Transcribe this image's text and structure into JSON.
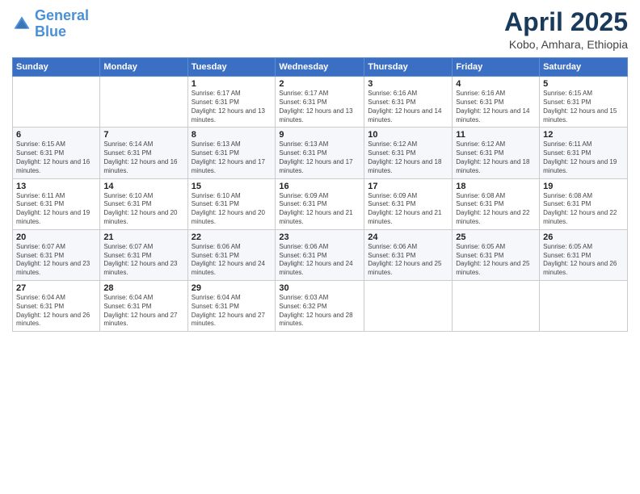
{
  "header": {
    "logo_line1": "General",
    "logo_line2": "Blue",
    "month_title": "April 2025",
    "location": "Kobo, Amhara, Ethiopia"
  },
  "days_of_week": [
    "Sunday",
    "Monday",
    "Tuesday",
    "Wednesday",
    "Thursday",
    "Friday",
    "Saturday"
  ],
  "weeks": [
    [
      {
        "num": "",
        "sunrise": "",
        "sunset": "",
        "daylight": ""
      },
      {
        "num": "",
        "sunrise": "",
        "sunset": "",
        "daylight": ""
      },
      {
        "num": "1",
        "sunrise": "Sunrise: 6:17 AM",
        "sunset": "Sunset: 6:31 PM",
        "daylight": "Daylight: 12 hours and 13 minutes."
      },
      {
        "num": "2",
        "sunrise": "Sunrise: 6:17 AM",
        "sunset": "Sunset: 6:31 PM",
        "daylight": "Daylight: 12 hours and 13 minutes."
      },
      {
        "num": "3",
        "sunrise": "Sunrise: 6:16 AM",
        "sunset": "Sunset: 6:31 PM",
        "daylight": "Daylight: 12 hours and 14 minutes."
      },
      {
        "num": "4",
        "sunrise": "Sunrise: 6:16 AM",
        "sunset": "Sunset: 6:31 PM",
        "daylight": "Daylight: 12 hours and 14 minutes."
      },
      {
        "num": "5",
        "sunrise": "Sunrise: 6:15 AM",
        "sunset": "Sunset: 6:31 PM",
        "daylight": "Daylight: 12 hours and 15 minutes."
      }
    ],
    [
      {
        "num": "6",
        "sunrise": "Sunrise: 6:15 AM",
        "sunset": "Sunset: 6:31 PM",
        "daylight": "Daylight: 12 hours and 16 minutes."
      },
      {
        "num": "7",
        "sunrise": "Sunrise: 6:14 AM",
        "sunset": "Sunset: 6:31 PM",
        "daylight": "Daylight: 12 hours and 16 minutes."
      },
      {
        "num": "8",
        "sunrise": "Sunrise: 6:13 AM",
        "sunset": "Sunset: 6:31 PM",
        "daylight": "Daylight: 12 hours and 17 minutes."
      },
      {
        "num": "9",
        "sunrise": "Sunrise: 6:13 AM",
        "sunset": "Sunset: 6:31 PM",
        "daylight": "Daylight: 12 hours and 17 minutes."
      },
      {
        "num": "10",
        "sunrise": "Sunrise: 6:12 AM",
        "sunset": "Sunset: 6:31 PM",
        "daylight": "Daylight: 12 hours and 18 minutes."
      },
      {
        "num": "11",
        "sunrise": "Sunrise: 6:12 AM",
        "sunset": "Sunset: 6:31 PM",
        "daylight": "Daylight: 12 hours and 18 minutes."
      },
      {
        "num": "12",
        "sunrise": "Sunrise: 6:11 AM",
        "sunset": "Sunset: 6:31 PM",
        "daylight": "Daylight: 12 hours and 19 minutes."
      }
    ],
    [
      {
        "num": "13",
        "sunrise": "Sunrise: 6:11 AM",
        "sunset": "Sunset: 6:31 PM",
        "daylight": "Daylight: 12 hours and 19 minutes."
      },
      {
        "num": "14",
        "sunrise": "Sunrise: 6:10 AM",
        "sunset": "Sunset: 6:31 PM",
        "daylight": "Daylight: 12 hours and 20 minutes."
      },
      {
        "num": "15",
        "sunrise": "Sunrise: 6:10 AM",
        "sunset": "Sunset: 6:31 PM",
        "daylight": "Daylight: 12 hours and 20 minutes."
      },
      {
        "num": "16",
        "sunrise": "Sunrise: 6:09 AM",
        "sunset": "Sunset: 6:31 PM",
        "daylight": "Daylight: 12 hours and 21 minutes."
      },
      {
        "num": "17",
        "sunrise": "Sunrise: 6:09 AM",
        "sunset": "Sunset: 6:31 PM",
        "daylight": "Daylight: 12 hours and 21 minutes."
      },
      {
        "num": "18",
        "sunrise": "Sunrise: 6:08 AM",
        "sunset": "Sunset: 6:31 PM",
        "daylight": "Daylight: 12 hours and 22 minutes."
      },
      {
        "num": "19",
        "sunrise": "Sunrise: 6:08 AM",
        "sunset": "Sunset: 6:31 PM",
        "daylight": "Daylight: 12 hours and 22 minutes."
      }
    ],
    [
      {
        "num": "20",
        "sunrise": "Sunrise: 6:07 AM",
        "sunset": "Sunset: 6:31 PM",
        "daylight": "Daylight: 12 hours and 23 minutes."
      },
      {
        "num": "21",
        "sunrise": "Sunrise: 6:07 AM",
        "sunset": "Sunset: 6:31 PM",
        "daylight": "Daylight: 12 hours and 23 minutes."
      },
      {
        "num": "22",
        "sunrise": "Sunrise: 6:06 AM",
        "sunset": "Sunset: 6:31 PM",
        "daylight": "Daylight: 12 hours and 24 minutes."
      },
      {
        "num": "23",
        "sunrise": "Sunrise: 6:06 AM",
        "sunset": "Sunset: 6:31 PM",
        "daylight": "Daylight: 12 hours and 24 minutes."
      },
      {
        "num": "24",
        "sunrise": "Sunrise: 6:06 AM",
        "sunset": "Sunset: 6:31 PM",
        "daylight": "Daylight: 12 hours and 25 minutes."
      },
      {
        "num": "25",
        "sunrise": "Sunrise: 6:05 AM",
        "sunset": "Sunset: 6:31 PM",
        "daylight": "Daylight: 12 hours and 25 minutes."
      },
      {
        "num": "26",
        "sunrise": "Sunrise: 6:05 AM",
        "sunset": "Sunset: 6:31 PM",
        "daylight": "Daylight: 12 hours and 26 minutes."
      }
    ],
    [
      {
        "num": "27",
        "sunrise": "Sunrise: 6:04 AM",
        "sunset": "Sunset: 6:31 PM",
        "daylight": "Daylight: 12 hours and 26 minutes."
      },
      {
        "num": "28",
        "sunrise": "Sunrise: 6:04 AM",
        "sunset": "Sunset: 6:31 PM",
        "daylight": "Daylight: 12 hours and 27 minutes."
      },
      {
        "num": "29",
        "sunrise": "Sunrise: 6:04 AM",
        "sunset": "Sunset: 6:31 PM",
        "daylight": "Daylight: 12 hours and 27 minutes."
      },
      {
        "num": "30",
        "sunrise": "Sunrise: 6:03 AM",
        "sunset": "Sunset: 6:32 PM",
        "daylight": "Daylight: 12 hours and 28 minutes."
      },
      {
        "num": "",
        "sunrise": "",
        "sunset": "",
        "daylight": ""
      },
      {
        "num": "",
        "sunrise": "",
        "sunset": "",
        "daylight": ""
      },
      {
        "num": "",
        "sunrise": "",
        "sunset": "",
        "daylight": ""
      }
    ]
  ]
}
